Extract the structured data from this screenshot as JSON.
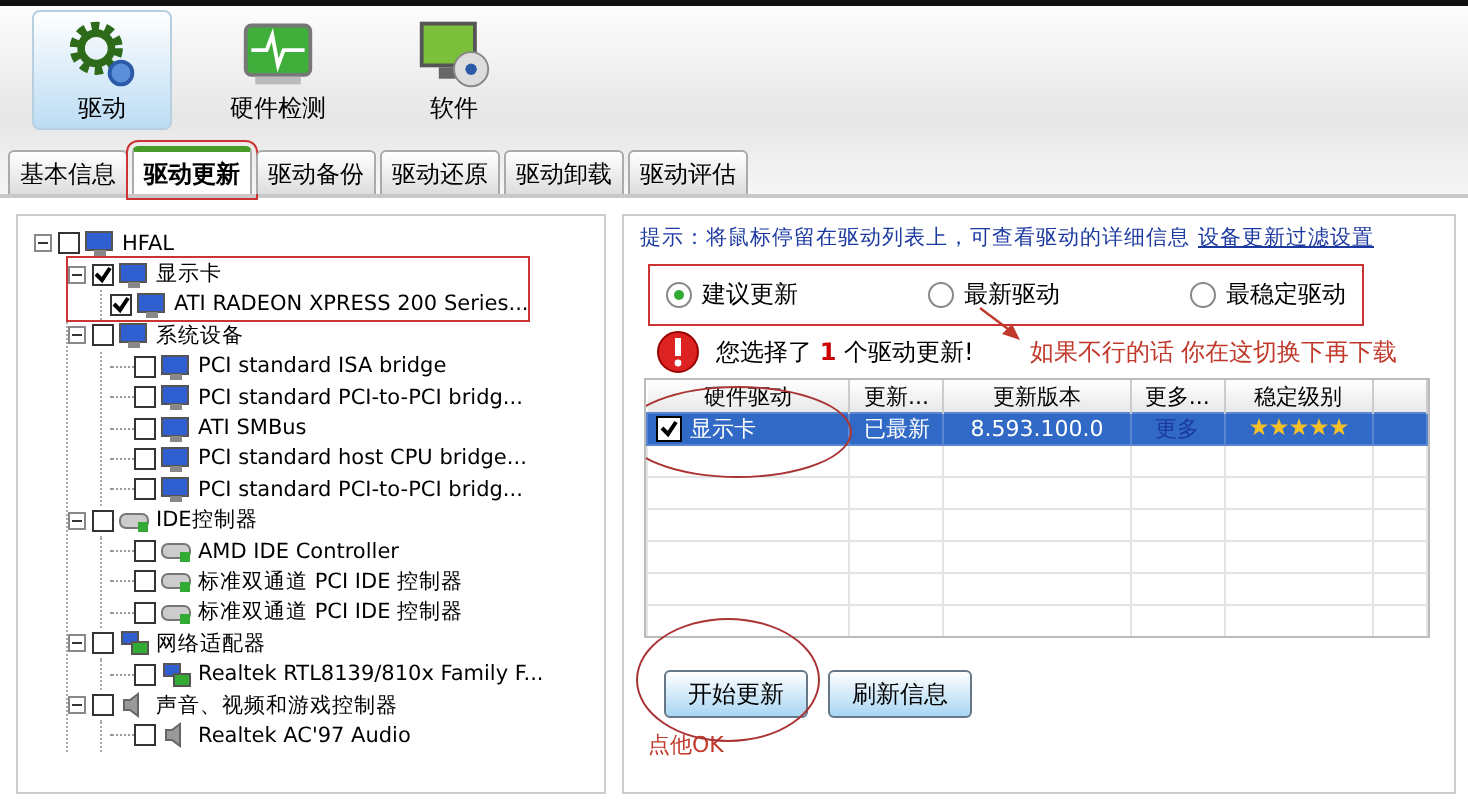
{
  "toolbar": [
    {
      "label": "驱动",
      "kind": "gear",
      "selected": true
    },
    {
      "label": "硬件检测",
      "kind": "pulse",
      "selected": false
    },
    {
      "label": "软件",
      "kind": "disc",
      "selected": false
    }
  ],
  "tabs": [
    {
      "label": "基本信息",
      "selected": false,
      "circled": false
    },
    {
      "label": "驱动更新",
      "selected": true,
      "circled": true
    },
    {
      "label": "驱动备份",
      "selected": false,
      "circled": false
    },
    {
      "label": "驱动还原",
      "selected": false,
      "circled": false
    },
    {
      "label": "驱动卸载",
      "selected": false,
      "circled": false
    },
    {
      "label": "驱动评估",
      "selected": false,
      "circled": false
    }
  ],
  "device_tree": [
    {
      "label": "HFAL",
      "kind": "monitor",
      "checked": false,
      "expanded": true,
      "circled": false,
      "children": [
        {
          "label": "显示卡",
          "kind": "monitor",
          "checked": true,
          "expanded": true,
          "circled": true,
          "children": [
            {
              "label": "ATI RADEON XPRESS 200 Series...",
              "kind": "monitor",
              "checked": true
            }
          ]
        },
        {
          "label": "系统设备",
          "kind": "monitor",
          "checked": false,
          "expanded": true,
          "circled": false,
          "children": [
            {
              "label": "PCI standard ISA bridge",
              "kind": "monitor",
              "checked": false
            },
            {
              "label": "PCI standard PCI-to-PCI bridg...",
              "kind": "monitor",
              "checked": false
            },
            {
              "label": "ATI SMBus",
              "kind": "monitor",
              "checked": false
            },
            {
              "label": "PCI standard host CPU bridge...",
              "kind": "monitor",
              "checked": false
            },
            {
              "label": "PCI standard PCI-to-PCI bridg...",
              "kind": "monitor",
              "checked": false
            }
          ]
        },
        {
          "label": "IDE控制器",
          "kind": "drive",
          "checked": false,
          "expanded": true,
          "circled": false,
          "children": [
            {
              "label": "AMD IDE Controller",
              "kind": "drive",
              "checked": false
            },
            {
              "label": "标准双通道 PCI IDE 控制器",
              "kind": "drive",
              "checked": false
            },
            {
              "label": "标准双通道 PCI IDE 控制器",
              "kind": "drive",
              "checked": false
            }
          ]
        },
        {
          "label": "网络适配器",
          "kind": "network",
          "checked": false,
          "expanded": true,
          "circled": false,
          "children": [
            {
              "label": "Realtek RTL8139/810x Family F...",
              "kind": "network",
              "checked": false
            }
          ]
        },
        {
          "label": "声音、视频和游戏控制器",
          "kind": "speaker",
          "checked": false,
          "expanded": true,
          "circled": false,
          "children": [
            {
              "label": "Realtek AC'97 Audio",
              "kind": "speaker",
              "checked": false
            }
          ]
        }
      ]
    }
  ],
  "hint": {
    "text": "提示：将鼠标停留在驱动列表上，可查看驱动的详细信息",
    "link": "设备更新过滤设置"
  },
  "update_modes": {
    "circled": true,
    "options": [
      {
        "label": "建议更新",
        "selected": true
      },
      {
        "label": "最新驱动",
        "selected": false
      },
      {
        "label": "最稳定驱动",
        "selected": false
      }
    ]
  },
  "notice": "您选择了 **1** 个驱动更新!",
  "annotation_switch": "如果不行的话  你在这切换下再下载",
  "driver_table": {
    "columns": [
      "硬件驱动",
      "更新...",
      "更新版本",
      "更多...",
      "稳定级别"
    ],
    "rows": [
      {
        "checked": true,
        "selected": true,
        "circled": true,
        "name": "显示卡",
        "status": "已最新",
        "version": "8.593.100.0",
        "more": "更多",
        "stars": 5
      }
    ]
  },
  "buttons": [
    {
      "label": "开始更新",
      "circled": true
    },
    {
      "label": "刷新信息",
      "circled": false
    }
  ],
  "annotation_ok": "点他OK"
}
